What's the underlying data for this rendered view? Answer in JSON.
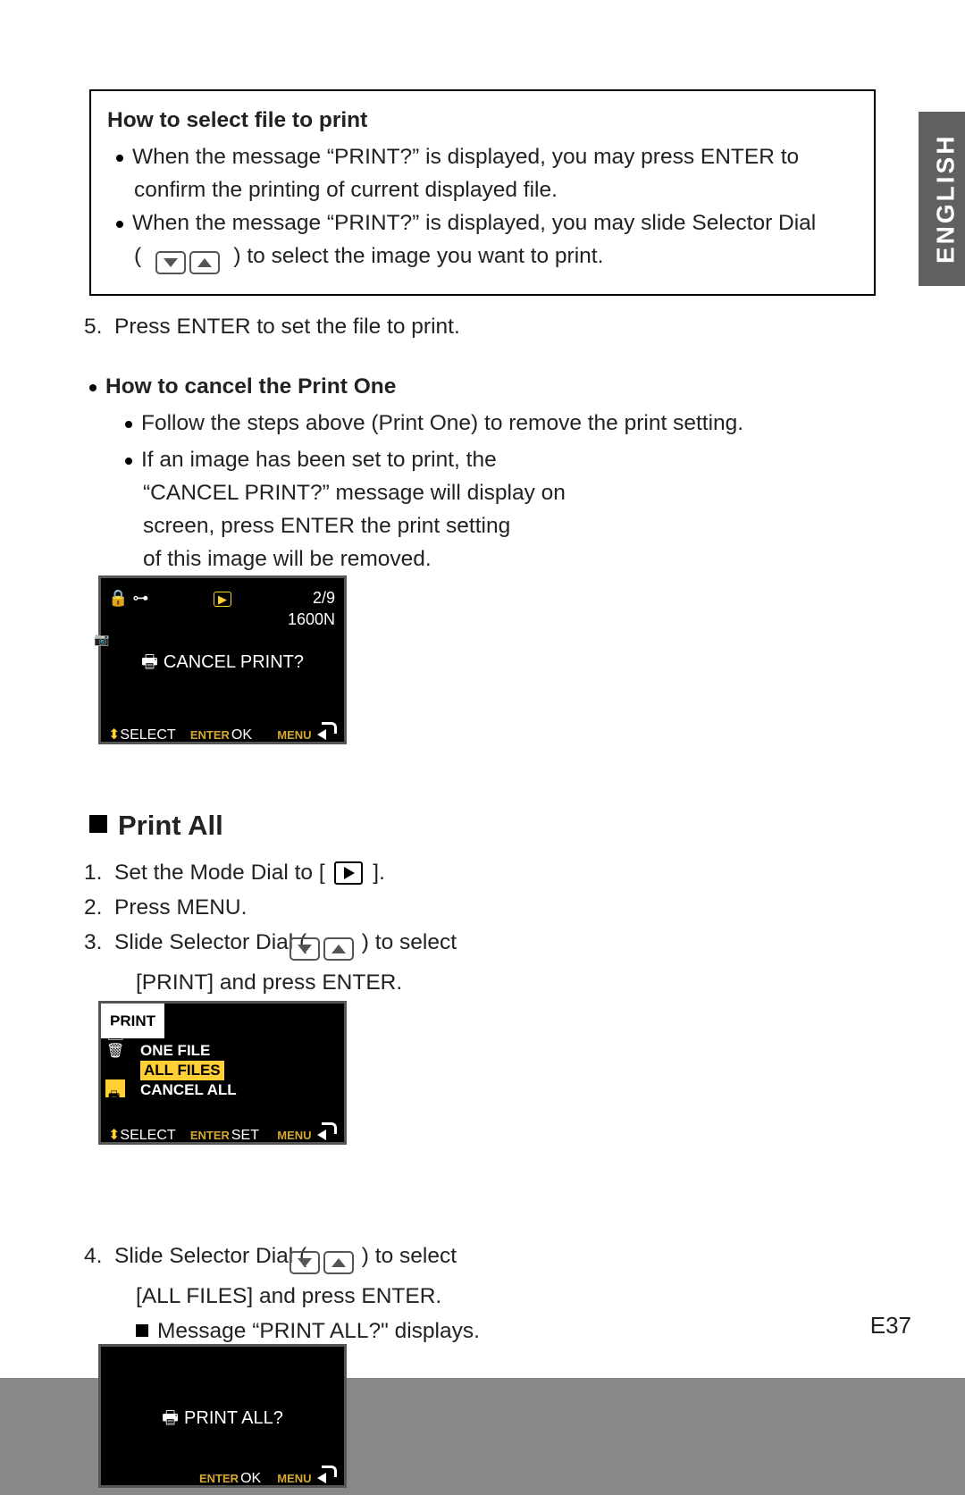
{
  "lang_tab": "ENGLISH",
  "page_number": "E37",
  "box": {
    "title": "How to select file to print",
    "b1a": "When the message “PRINT?” is displayed, you may press ENTER to",
    "b1b": "confirm the printing of current displayed file.",
    "b2a": "When the message “PRINT?” is displayed, you may slide Selector Dial",
    "b2b_pre": "( ",
    "b2b_post": " ) to select the image you want to print."
  },
  "step5": "5.  Press ENTER to set the file to print.",
  "cancel": {
    "heading": "How to cancel the Print One",
    "b1": "Follow the steps above (Print One) to remove the print setting.",
    "b2a": "If an image has been set to print, the",
    "b2b": "“CANCEL PRINT?” message will display on",
    "b2c": "screen, press ENTER the print setting",
    "b2d": "of this image will be removed."
  },
  "printall": {
    "heading": "Print All",
    "s1_pre": "1.  Set the Mode Dial to [ ",
    "s1_post": " ].",
    "s2": "2.  Press MENU.",
    "s3_pre": "3.  Slide Selector Dial ( ",
    "s3_post": " ) to select",
    "s3b": "[PRINT] and press ENTER.",
    "s4_pre": "4.  Slide Selector Dial ( ",
    "s4_post": " ) to select",
    "s4b": "[ALL FILES] and press ENTER.",
    "s4c": "Message “PRINT ALL?\" displays."
  },
  "lcd1": {
    "counter": "2/9",
    "res": "1600N",
    "msg": "CANCEL PRINT?",
    "select": "SELECT",
    "enter": "ENTER",
    "ok": "OK",
    "menu": "MENU"
  },
  "lcd2": {
    "title": "PRINT",
    "i1": "ONE FILE",
    "i2": "ALL FILES",
    "i3": "CANCEL ALL",
    "select": "SELECT",
    "enter": "ENTER",
    "set": "SET",
    "menu": "MENU"
  },
  "lcd3": {
    "msg": "PRINT ALL?",
    "enter": "ENTER",
    "ok": "OK",
    "menu": "MENU"
  }
}
